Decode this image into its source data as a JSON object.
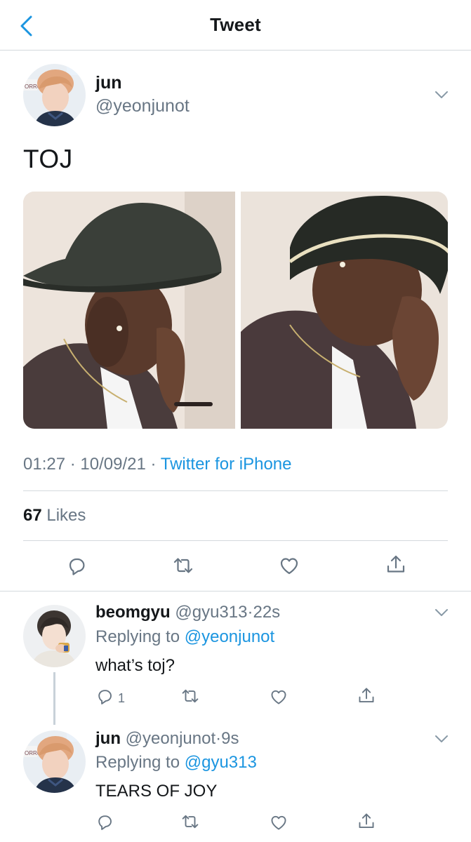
{
  "header": {
    "title": "Tweet",
    "back_icon": "chevron-left-icon"
  },
  "tweet": {
    "author_name": "jun",
    "author_handle": "@yeonjunot",
    "text": "TOJ",
    "time": "01:27",
    "date": "10/09/21",
    "source": "Twitter for iPhone",
    "likes_count": "67",
    "likes_label": "Likes",
    "actions": [
      "reply-icon",
      "retweet-icon",
      "like-icon",
      "share-icon"
    ]
  },
  "replies": [
    {
      "name": "beomgyu",
      "handle": "@gyu313",
      "age": "22s",
      "replying_label": "Replying to",
      "replying_to": "@yeonjunot",
      "text": "what’s toj?",
      "reply_count": "1"
    },
    {
      "name": "jun",
      "handle": "@yeonjunot",
      "age": "9s",
      "replying_label": "Replying to",
      "replying_to": "@gyu313",
      "text": "TEARS OF JOY",
      "reply_count": ""
    }
  ],
  "colors": {
    "link": "#1b95e0",
    "muted": "#687684",
    "text": "#14171a",
    "border": "#d4d9dd"
  }
}
